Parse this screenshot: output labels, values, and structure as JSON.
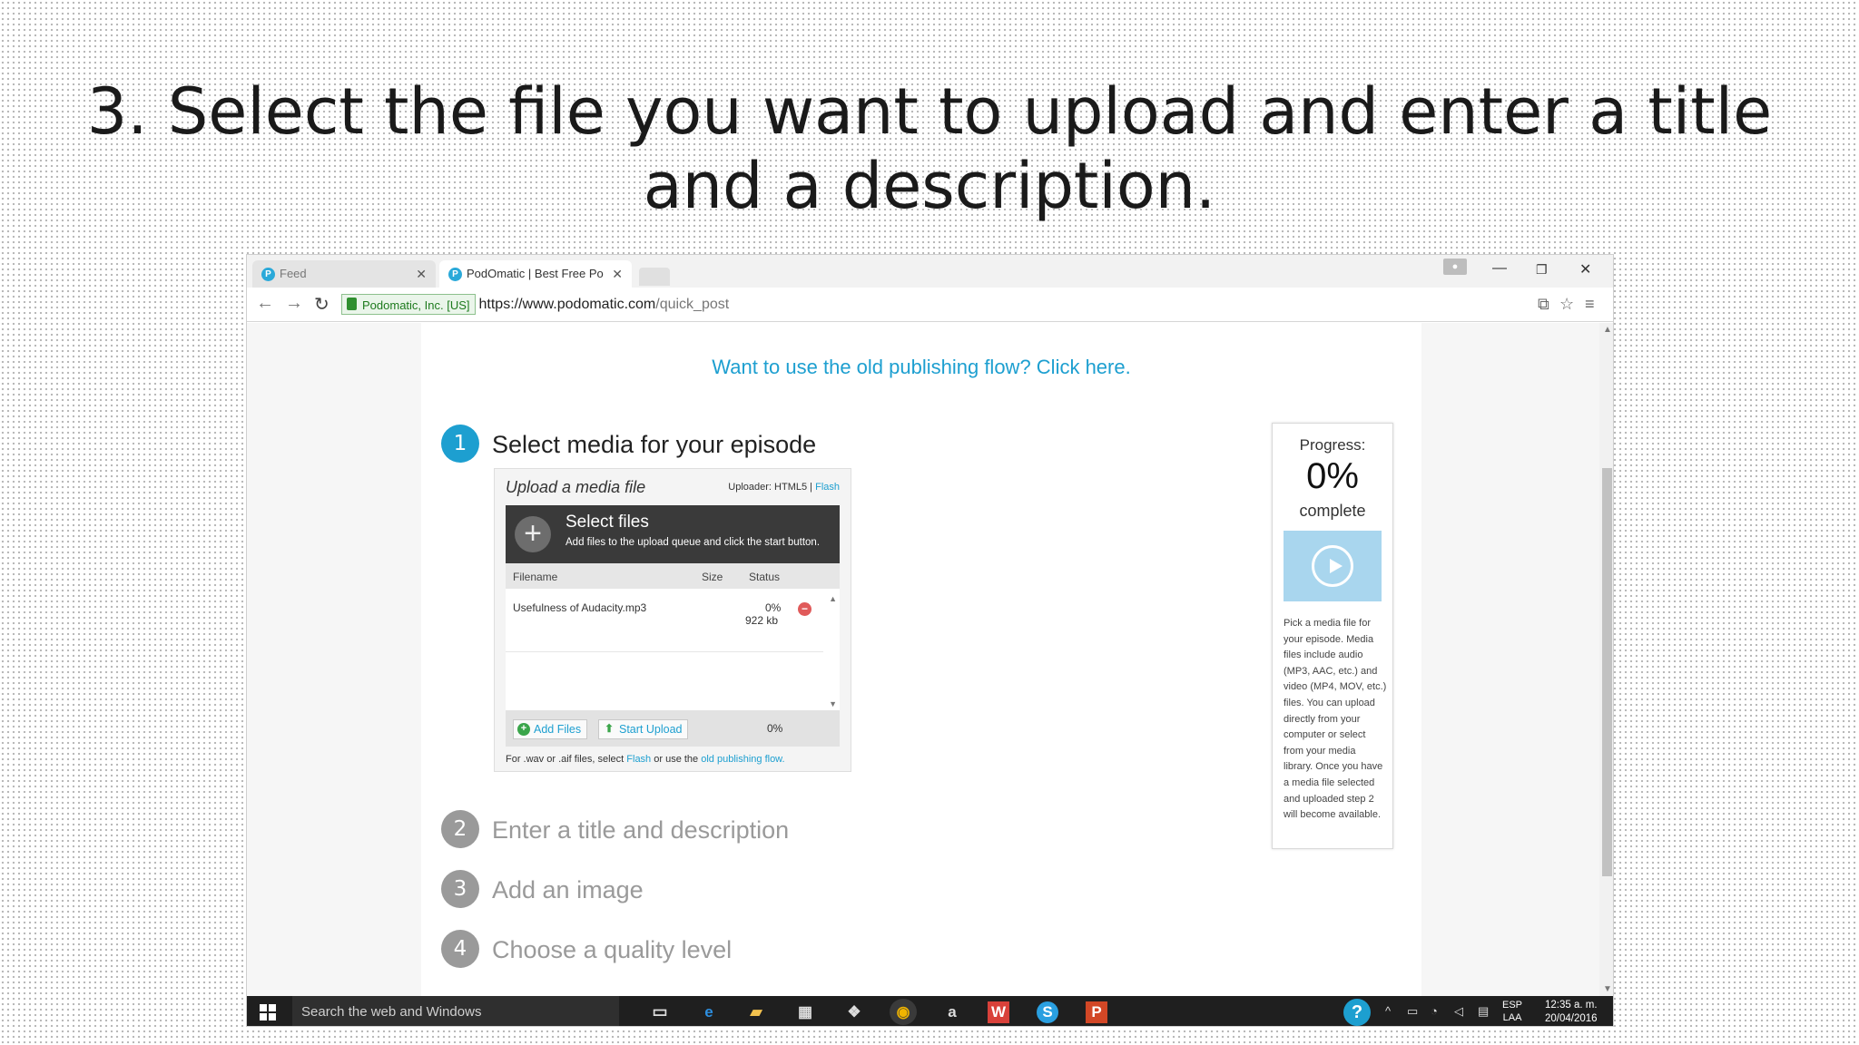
{
  "slide": {
    "title_line1": "3. Select the file you want to upload and enter a title",
    "title_line2": "and a description."
  },
  "browser": {
    "tabs": [
      {
        "label": "Feed",
        "favicon": "podomatic-icon"
      },
      {
        "label": "PodOmatic | Best Free Po",
        "favicon": "podomatic-icon",
        "active": true
      }
    ],
    "ev_badge": "Podomatic, Inc. [US]",
    "url_scheme_host": "https://www.podomatic.com",
    "url_path": "/quick_post"
  },
  "page": {
    "old_flow_link": "Want to use the old publishing flow? Click here.",
    "steps": [
      {
        "num": "1",
        "label": "Select media for your episode",
        "active": true
      },
      {
        "num": "2",
        "label": "Enter a title and description"
      },
      {
        "num": "3",
        "label": "Add an image"
      },
      {
        "num": "4",
        "label": "Choose a quality level"
      }
    ],
    "uploader": {
      "heading": "Upload a media file",
      "mode_label": "Uploader: HTML5 |",
      "mode_flash": "Flash",
      "select_title": "Select files",
      "select_subtitle": "Add files to the upload queue and click the start button.",
      "columns": [
        "Filename",
        "Size",
        "Status"
      ],
      "file": {
        "name": "Usefulness of Audacity.mp3",
        "percent": "0%",
        "size": "922 kb"
      },
      "add_files_label": "Add Files",
      "start_upload_label": "Start Upload",
      "total_percent": "0%",
      "note_prefix": "For .wav or .aif files, select",
      "note_flash": "Flash",
      "note_middle": "or use the",
      "note_link": "old publishing flow."
    },
    "progress": {
      "label": "Progress:",
      "value": "0%",
      "complete": "complete",
      "help": "Pick a media file for your episode. Media files include audio (MP3, AAC, etc.) and video (MP4, MOV, etc.) files. You can upload directly from your computer or select from your media library. Once you have a media file selected and uploaded step 2 will become available."
    }
  },
  "taskbar": {
    "search_placeholder": "Search the web and Windows",
    "lang_line1": "ESP",
    "lang_line2": "LAA",
    "time": "12:35 a. m.",
    "date": "20/04/2016"
  },
  "colors": {
    "accent": "#1d9fd0",
    "step_inactive": "#9a9a9a",
    "taskbar": "#1f1f1f"
  }
}
